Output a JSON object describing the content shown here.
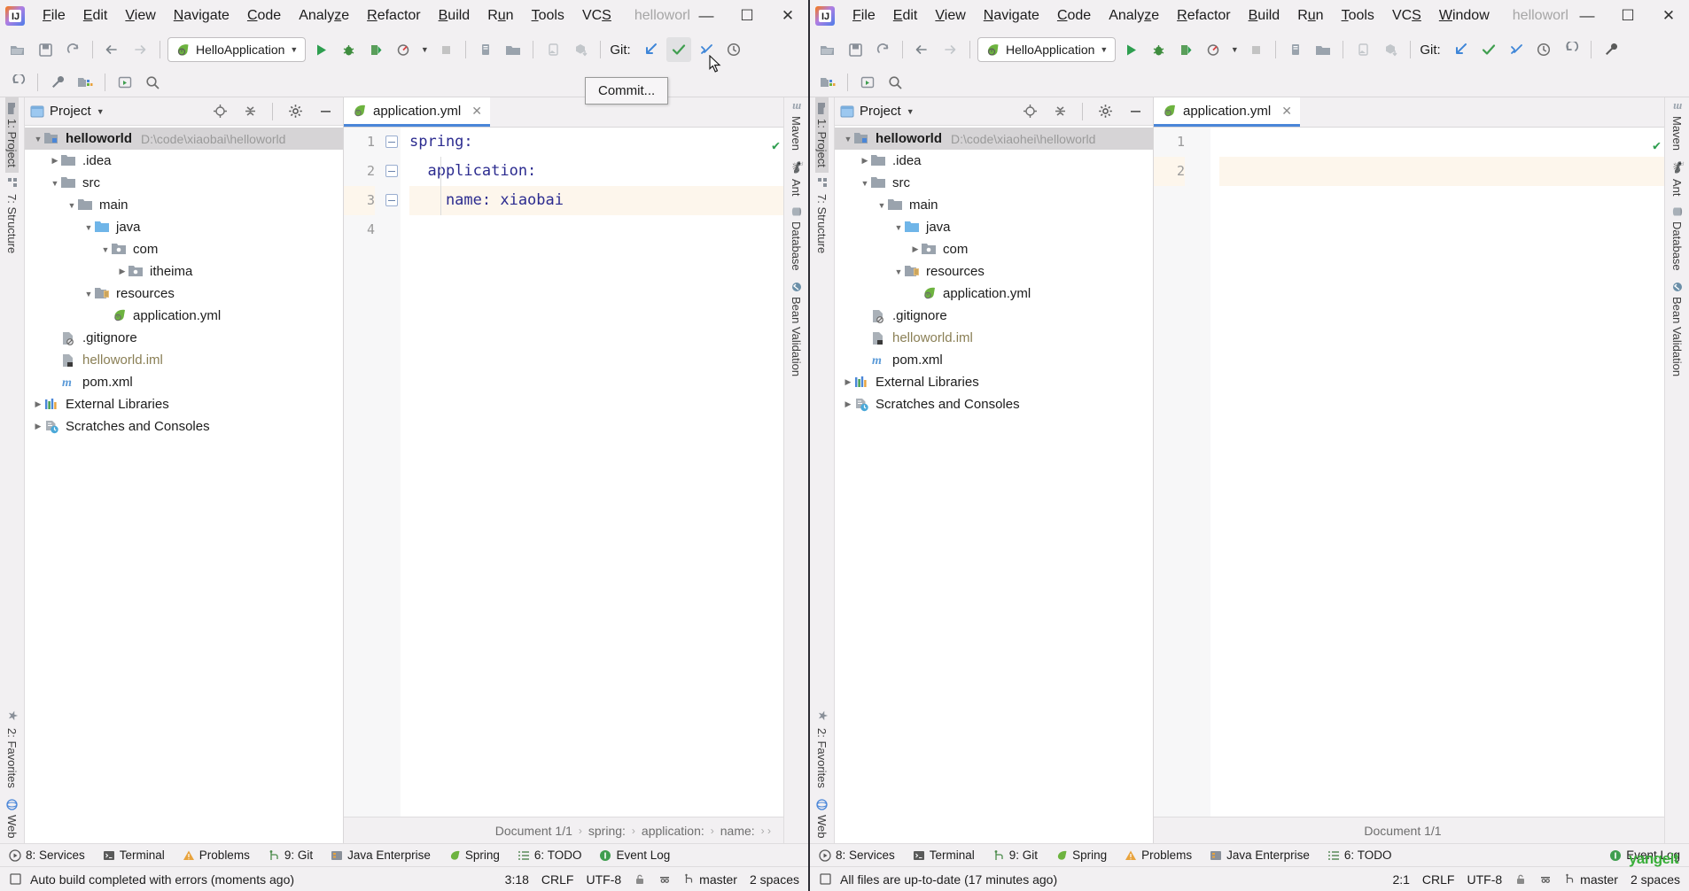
{
  "left": {
    "menu": [
      "File",
      "Edit",
      "View",
      "Navigate",
      "Code",
      "Analyze",
      "Refactor",
      "Build",
      "Run",
      "Tools",
      "VCS"
    ],
    "project_name": "helloworl",
    "window_controls": [
      "—",
      "☐",
      "✕"
    ],
    "run_config": "HelloApplication",
    "git_label": "Git:",
    "project_panel": {
      "title": "Project",
      "tree": [
        {
          "label": "helloworld",
          "path": "D:\\code\\xiaobai\\helloworld",
          "icon": "module-icon",
          "depth": 0,
          "arrow": "down",
          "selected": true,
          "bold": true
        },
        {
          "label": ".idea",
          "path": "",
          "icon": "folder-icon",
          "depth": 1,
          "arrow": "right",
          "selected": false,
          "bold": false
        },
        {
          "label": "src",
          "path": "",
          "icon": "folder-icon",
          "depth": 1,
          "arrow": "down",
          "selected": false,
          "bold": false
        },
        {
          "label": "main",
          "path": "",
          "icon": "folder-icon",
          "depth": 2,
          "arrow": "down",
          "selected": false,
          "bold": false
        },
        {
          "label": "java",
          "path": "",
          "icon": "source-folder-icon",
          "depth": 3,
          "arrow": "down",
          "selected": false,
          "bold": false
        },
        {
          "label": "com",
          "path": "",
          "icon": "package-icon",
          "depth": 4,
          "arrow": "down",
          "selected": false,
          "bold": false
        },
        {
          "label": "itheima",
          "path": "",
          "icon": "package-icon",
          "depth": 5,
          "arrow": "right",
          "selected": false,
          "bold": false
        },
        {
          "label": "resources",
          "path": "",
          "icon": "resources-folder-icon",
          "depth": 3,
          "arrow": "down",
          "selected": false,
          "bold": false
        },
        {
          "label": "application.yml",
          "path": "",
          "icon": "spring-yaml-icon",
          "depth": 4,
          "arrow": "",
          "selected": false,
          "bold": false
        },
        {
          "label": ".gitignore",
          "path": "",
          "icon": "gitignore-icon",
          "depth": 1,
          "arrow": "",
          "selected": false,
          "bold": false
        },
        {
          "label": "helloworld.iml",
          "path": "",
          "icon": "iml-icon",
          "depth": 1,
          "arrow": "",
          "selected": false,
          "bold": false
        },
        {
          "label": "pom.xml",
          "path": "",
          "icon": "maven-icon",
          "depth": 1,
          "arrow": "",
          "selected": false,
          "bold": false
        },
        {
          "label": "External Libraries",
          "path": "",
          "icon": "libraries-icon",
          "depth": 0,
          "arrow": "right",
          "selected": false,
          "bold": false
        },
        {
          "label": "Scratches and Consoles",
          "path": "",
          "icon": "scratches-icon",
          "depth": 0,
          "arrow": "right",
          "selected": false,
          "bold": false
        }
      ]
    },
    "tab": {
      "label": "application.yml",
      "close": "✕"
    },
    "code_lines": [
      {
        "num": "1",
        "text": "spring:",
        "highlight": false,
        "fold": true
      },
      {
        "num": "2",
        "text": "  application:",
        "highlight": false,
        "fold": true
      },
      {
        "num": "3",
        "text": "    name: xiaobai",
        "highlight": true,
        "fold": true
      },
      {
        "num": "4",
        "text": "",
        "highlight": false,
        "fold": false
      }
    ],
    "breadcrumb": [
      "Document 1/1",
      "spring:",
      "application:",
      "name:"
    ],
    "breadcrumb_overflow": "›",
    "tool_strip_left": [
      "1: Project",
      "7: Structure",
      "2: Favorites",
      "Web"
    ],
    "tool_strip_right": [
      "Maven",
      "Ant",
      "Database",
      "Bean Validation"
    ],
    "status_items": [
      "8: Services",
      "Terminal",
      "Problems",
      "9: Git",
      "Java Enterprise",
      "Spring",
      "6: TODO",
      "Event Log"
    ],
    "status_message": "Auto build completed with errors (moments ago)",
    "status_right": [
      "3:18",
      "CRLF",
      "UTF-8",
      "master",
      "2 spaces"
    ],
    "tooltip": "Commit..."
  },
  "right": {
    "menu": [
      "File",
      "Edit",
      "View",
      "Navigate",
      "Code",
      "Analyze",
      "Refactor",
      "Build",
      "Run",
      "Tools",
      "VCS",
      "Window"
    ],
    "project_name": "helloworl",
    "window_controls": [
      "—",
      "☐",
      "✕"
    ],
    "run_config": "HelloApplication",
    "git_label": "Git:",
    "project_panel": {
      "title": "Project",
      "tree": [
        {
          "label": "helloworld",
          "path": "D:\\code\\xiaohei\\helloworld",
          "icon": "module-icon",
          "depth": 0,
          "arrow": "down",
          "selected": true,
          "bold": true
        },
        {
          "label": ".idea",
          "path": "",
          "icon": "folder-icon",
          "depth": 1,
          "arrow": "right",
          "selected": false,
          "bold": false
        },
        {
          "label": "src",
          "path": "",
          "icon": "folder-icon",
          "depth": 1,
          "arrow": "down",
          "selected": false,
          "bold": false
        },
        {
          "label": "main",
          "path": "",
          "icon": "folder-icon",
          "depth": 2,
          "arrow": "down",
          "selected": false,
          "bold": false
        },
        {
          "label": "java",
          "path": "",
          "icon": "source-folder-icon",
          "depth": 3,
          "arrow": "down",
          "selected": false,
          "bold": false
        },
        {
          "label": "com",
          "path": "",
          "icon": "package-icon",
          "depth": 4,
          "arrow": "right",
          "selected": false,
          "bold": false
        },
        {
          "label": "resources",
          "path": "",
          "icon": "resources-folder-icon",
          "depth": 3,
          "arrow": "down",
          "selected": false,
          "bold": false
        },
        {
          "label": "application.yml",
          "path": "",
          "icon": "spring-yaml-icon",
          "depth": 4,
          "arrow": "",
          "selected": false,
          "bold": false
        },
        {
          "label": ".gitignore",
          "path": "",
          "icon": "gitignore-icon",
          "depth": 1,
          "arrow": "",
          "selected": false,
          "bold": false
        },
        {
          "label": "helloworld.iml",
          "path": "",
          "icon": "iml-icon",
          "depth": 1,
          "arrow": "",
          "selected": false,
          "bold": false
        },
        {
          "label": "pom.xml",
          "path": "",
          "icon": "maven-icon",
          "depth": 1,
          "arrow": "",
          "selected": false,
          "bold": false
        },
        {
          "label": "External Libraries",
          "path": "",
          "icon": "libraries-icon",
          "depth": 0,
          "arrow": "right",
          "selected": false,
          "bold": false
        },
        {
          "label": "Scratches and Consoles",
          "path": "",
          "icon": "scratches-icon",
          "depth": 0,
          "arrow": "right",
          "selected": false,
          "bold": false
        }
      ]
    },
    "tab": {
      "label": "application.yml",
      "close": "✕"
    },
    "code_lines": [
      {
        "num": "1",
        "text": "",
        "highlight": false,
        "fold": false
      },
      {
        "num": "2",
        "text": "",
        "highlight": true,
        "fold": false
      }
    ],
    "breadcrumb": [
      "Document 1/1"
    ],
    "tool_strip_left": [
      "1: Project",
      "7: Structure",
      "2: Favorites",
      "Web"
    ],
    "tool_strip_right": [
      "Maven",
      "Ant",
      "Database",
      "Bean Validation"
    ],
    "status_items": [
      "8: Services",
      "Terminal",
      "9: Git",
      "Spring",
      "Problems",
      "Java Enterprise",
      "6: TODO",
      "Event Log"
    ],
    "status_message": "All files are up-to-date (17 minutes ago)",
    "status_right": [
      "2:1",
      "CRLF",
      "UTF-8",
      "master",
      "2 spaces"
    ],
    "watermark": "yangeit"
  },
  "colors": {
    "accent_blue": "#4a86d8",
    "run_green": "#2e9e4f",
    "warn_orange": "#e8a33d",
    "panel_bg": "#f2f0f2",
    "selection": "#d6d4d6",
    "code_text": "#2b2b8f",
    "highlight_line": "#fdf6ec"
  }
}
